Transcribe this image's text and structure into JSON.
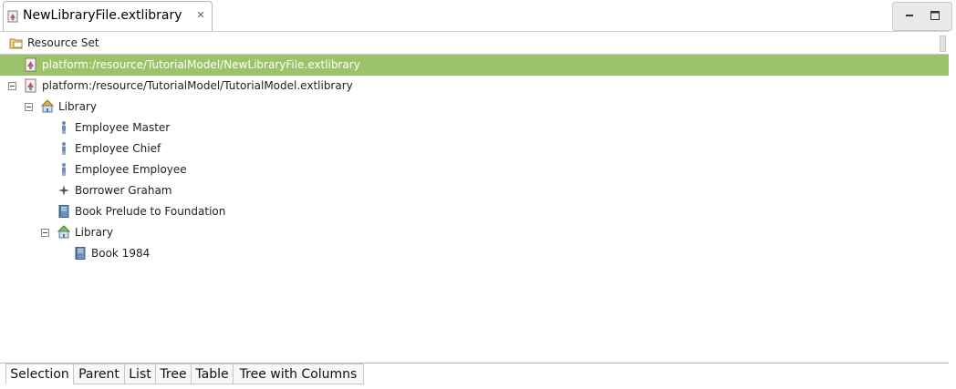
{
  "editor": {
    "tab_title": "NewLibraryFile.extlibrary",
    "tab_icon": "extlibrary-file-icon",
    "close_icon": "close-icon"
  },
  "window_controls": {
    "minimize_icon": "minimize-icon",
    "maximize_icon": "maximize-icon"
  },
  "tree": {
    "rows": [
      {
        "label": "Resource Set",
        "icon": "folder-icon",
        "expandable": false
      },
      {
        "label": "platform:/resource/TutorialModel/NewLibraryFile.extlibrary",
        "icon": "resource-icon",
        "selected": true
      },
      {
        "label": "platform:/resource/TutorialModel/TutorialModel.extlibrary",
        "icon": "resource-icon",
        "expanded": true
      },
      {
        "label": "Library",
        "icon": "library-icon",
        "expanded": true
      },
      {
        "label": "Employee Master",
        "icon": "employee-icon"
      },
      {
        "label": "Employee Chief",
        "icon": "employee-icon"
      },
      {
        "label": "Employee Employee",
        "icon": "employee-icon"
      },
      {
        "label": "Borrower Graham",
        "icon": "borrower-icon"
      },
      {
        "label": "Book Prelude to Foundation",
        "icon": "book-icon"
      },
      {
        "label": "Library",
        "icon": "library-icon",
        "expanded": true
      },
      {
        "label": "Book 1984",
        "icon": "book-icon"
      }
    ]
  },
  "bottom_tabs": [
    {
      "label": "Selection",
      "active": true
    },
    {
      "label": "Parent"
    },
    {
      "label": "List"
    },
    {
      "label": "Tree"
    },
    {
      "label": "Table"
    },
    {
      "label": "Tree with Columns"
    }
  ],
  "colors": {
    "selection": "#9bc46a",
    "selected_text": "#ffffff"
  }
}
